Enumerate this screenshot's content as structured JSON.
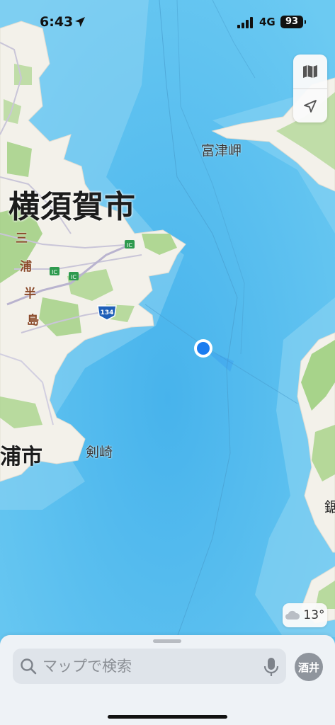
{
  "status_bar": {
    "time": "6:43",
    "network": "4G",
    "battery": "93"
  },
  "map_labels": {
    "yokosuka": "横須賀市",
    "futtsu_cape": "富津岬",
    "tsurugizaki": "剣崎",
    "miura_city": "浦市",
    "kyonan": "鋸",
    "peninsula": [
      "三",
      "浦",
      "半",
      "島"
    ]
  },
  "road_badges": {
    "route_134": "134",
    "ic_1": "IC",
    "ic_2": "IC",
    "ic_3": "IC"
  },
  "weather": {
    "temperature": "13°",
    "icon": "cloud-icon"
  },
  "search": {
    "placeholder": "マップで検索"
  },
  "avatar": {
    "initials": "酒井"
  },
  "colors": {
    "sea": "#5ec0ee",
    "land": "#f3f1ea",
    "green": "#a9d48b",
    "location": "#1a7cf0"
  }
}
